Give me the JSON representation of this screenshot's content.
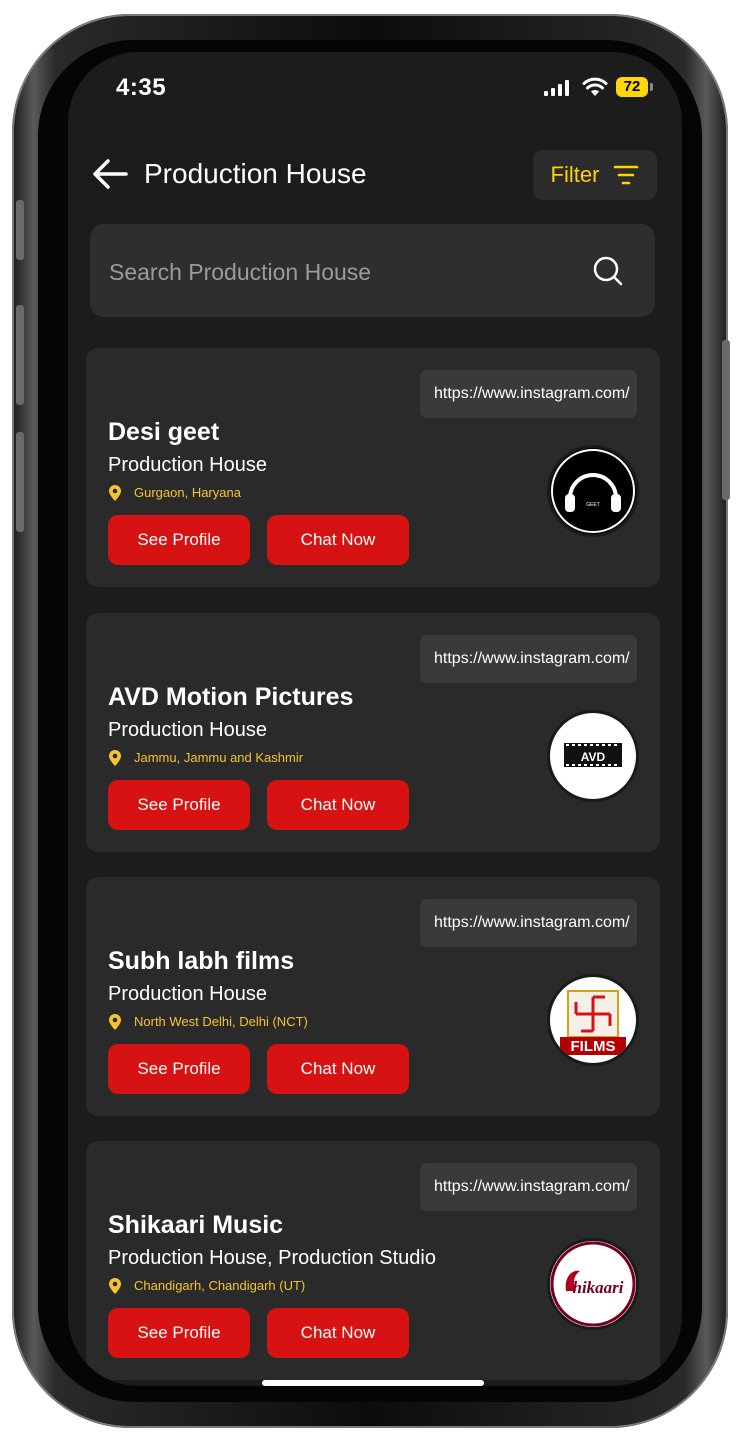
{
  "status_bar": {
    "time": "4:35",
    "battery": "72"
  },
  "header": {
    "title": "Production House",
    "filter_label": "Filter"
  },
  "search": {
    "placeholder": "Search Production House"
  },
  "cards": [
    {
      "name": "Desi geet",
      "type": "Production House",
      "location": "Gurgaon, Haryana",
      "link": "https://www.instagram.com/",
      "see_profile": "See Profile",
      "chat_now": "Chat Now",
      "logo_text": "GEET"
    },
    {
      "name": "AVD Motion Pictures",
      "type": "Production House",
      "location": "Jammu, Jammu and Kashmir",
      "link": "https://www.instagram.com/",
      "see_profile": "See Profile",
      "chat_now": "Chat Now",
      "logo_text": "AVD"
    },
    {
      "name": "Subh labh films",
      "type": "Production House",
      "location": "North West  Delhi, Delhi (NCT)",
      "link": "https://www.instagram.com/",
      "see_profile": "See Profile",
      "chat_now": "Chat Now",
      "logo_text": "FILMS"
    },
    {
      "name": "Shikaari Music",
      "type": "Production House, Production  Studio",
      "location": "Chandigarh, Chandigarh (UT)",
      "link": "https://www.instagram.com/",
      "see_profile": "See Profile",
      "chat_now": "Chat Now",
      "logo_text": "hikaari"
    }
  ],
  "colors": {
    "accent_red": "#d61212",
    "accent_yellow": "#ffd400",
    "card_bg": "#2a2a2a",
    "screen_bg": "#1c1c1c"
  }
}
